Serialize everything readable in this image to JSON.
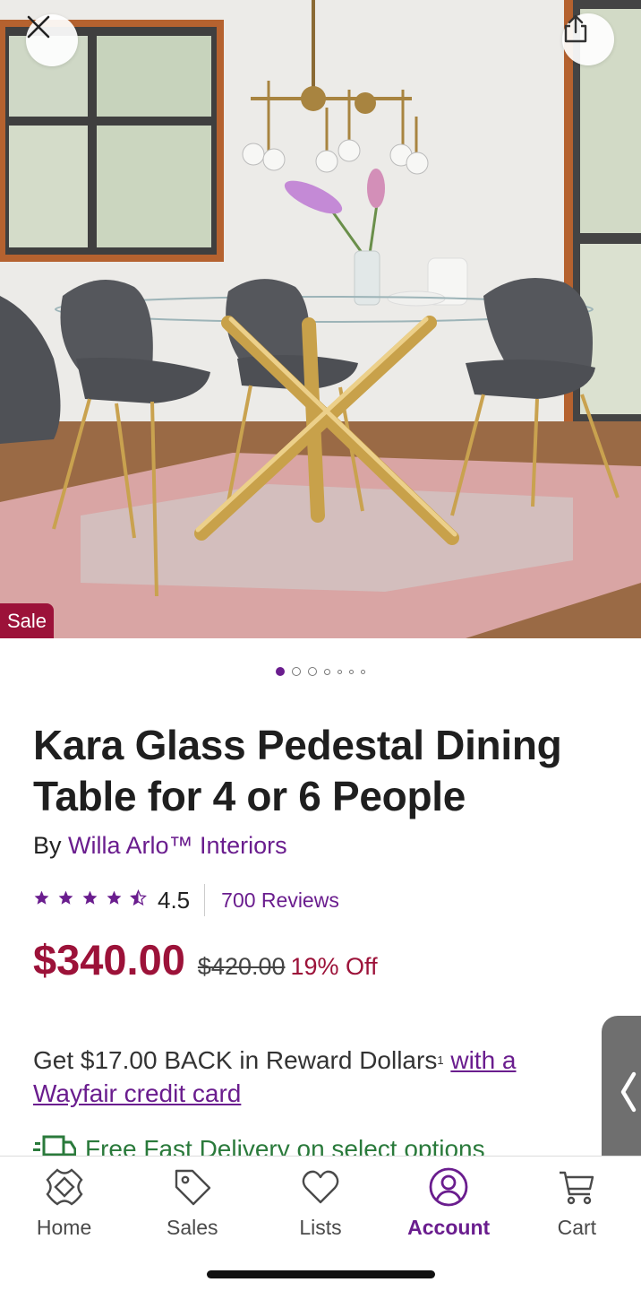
{
  "hero": {
    "close_icon": "close-icon",
    "share_icon": "share-icon",
    "sale_badge": "Sale",
    "carousel_total": 7,
    "carousel_active": 0
  },
  "product": {
    "title": "Kara Glass Pedestal Dining Table for 4 or 6 People",
    "brand_prefix": "By",
    "brand_name": "Willa Arlo™ Interiors",
    "rating": "4.5",
    "rating_value": 4.5,
    "reviews_label": "700 Reviews",
    "price": "$340.00",
    "old_price": "$420.00",
    "discount": "19% Off"
  },
  "reward": {
    "text": "Get $17.00 BACK in Reward Dollars",
    "footnote": "1",
    "link_text": "with a Wayfair credit card"
  },
  "delivery": {
    "text": "Free Fast Delivery on select options",
    "icon": "truck-icon"
  },
  "nav": {
    "items": [
      {
        "label": "Home",
        "icon": "home-icon"
      },
      {
        "label": "Sales",
        "icon": "tag-icon"
      },
      {
        "label": "Lists",
        "icon": "heart-icon"
      },
      {
        "label": "Account",
        "icon": "user-icon"
      },
      {
        "label": "Cart",
        "icon": "cart-icon"
      }
    ],
    "active": "Account"
  },
  "colors": {
    "brand_purple": "#6a1d8e",
    "sale_red": "#9c1239",
    "delivery_green": "#2a7a3b"
  }
}
